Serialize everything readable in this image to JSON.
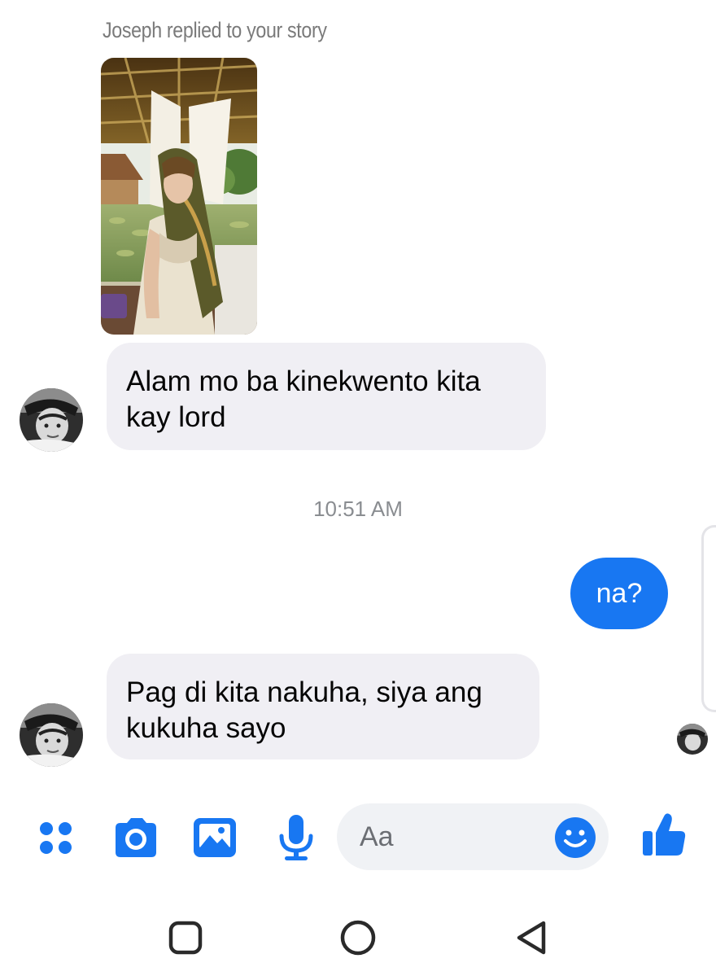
{
  "story": {
    "reply_header": "Joseph replied to your story"
  },
  "messages": [
    {
      "direction": "incoming",
      "line1": "Alam mo ba kinekwento kita",
      "line2": "kay lord"
    },
    {
      "direction": "outgoing",
      "text": "na?"
    },
    {
      "direction": "incoming",
      "line1": "Pag di kita nakuha, siya ang",
      "line2": "kukuha sayo"
    }
  ],
  "timestamp": "10:51 AM",
  "composer": {
    "placeholder": "Aa",
    "tools": [
      "apps-icon",
      "camera-icon",
      "gallery-icon",
      "microphone-icon"
    ],
    "emoji": "emoji-icon",
    "like": "thumbs-up-icon"
  },
  "navbar": {
    "buttons": [
      "recent-apps-icon",
      "home-icon",
      "back-icon"
    ]
  },
  "colors": {
    "accent": "#1877f2",
    "incoming_bubble": "#f0eff4",
    "meta_text": "#8a8d91",
    "header_text": "#7a7a7a"
  }
}
